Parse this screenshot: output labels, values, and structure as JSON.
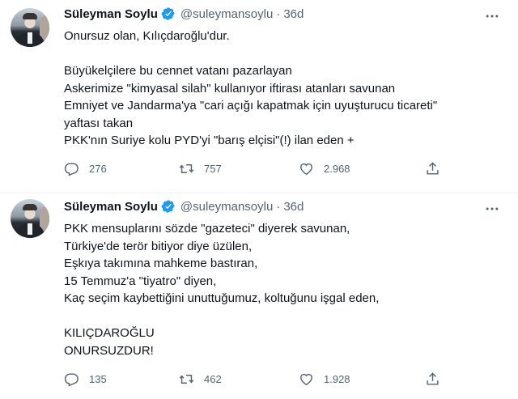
{
  "tweets": [
    {
      "name": "Süleyman Soylu",
      "handle": "@suleymansoylu",
      "separator": "·",
      "time": "36d",
      "text": "Onursuz olan, Kılıçdaroğlu'dur.\n\nBüyükelçilere bu cennet vatanı pazarlayan\nAskerimize \"kimyasal silah\" kullanıyor iftirası atanları savunan\nEmniyet ve Jandarma'ya \"cari açığı kapatmak için uyuşturucu ticareti\"\nyaftası takan\nPKK'nın Suriye kolu PYD'yi \"barış elçisi\"(!) ilan eden +",
      "replies": "276",
      "retweets": "757",
      "likes": "2.968"
    },
    {
      "name": "Süleyman Soylu",
      "handle": "@suleymansoylu",
      "separator": "·",
      "time": "36d",
      "text": "PKK mensuplarını sözde \"gazeteci\" diyerek savunan,\nTürkiye'de terör bitiyor diye üzülen,\nEşkıya takımına mahkeme bastıran,\n15 Temmuz'a \"tiyatro\" diyen,\nKaç seçim kaybettiğini unuttuğumuz, koltuğunu işgal eden,\n\nKILIÇDAROĞLU\nONURSUZDUR!",
      "replies": "135",
      "retweets": "462",
      "likes": "1.928"
    }
  ],
  "colors": {
    "verified": "#1d9bf0",
    "text": "#0f1419",
    "muted": "#536471",
    "divider": "#eff3f4"
  }
}
